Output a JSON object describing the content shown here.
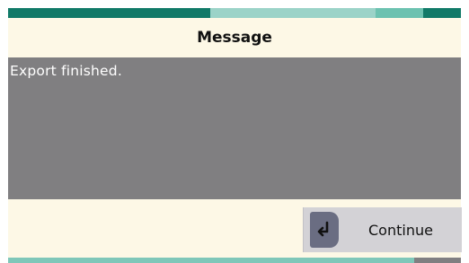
{
  "dialog": {
    "title": "Message",
    "message": "Export finished.",
    "continue_label": "Continue",
    "continue_icon": "enter-return-icon"
  },
  "colors": {
    "background": "#fdf8e6",
    "message_area": "#807f81",
    "accent_dark": "#117a68",
    "accent_light": "#9bd3c8",
    "button": "#d3d2d6",
    "button_icon": "#6a6d82"
  }
}
